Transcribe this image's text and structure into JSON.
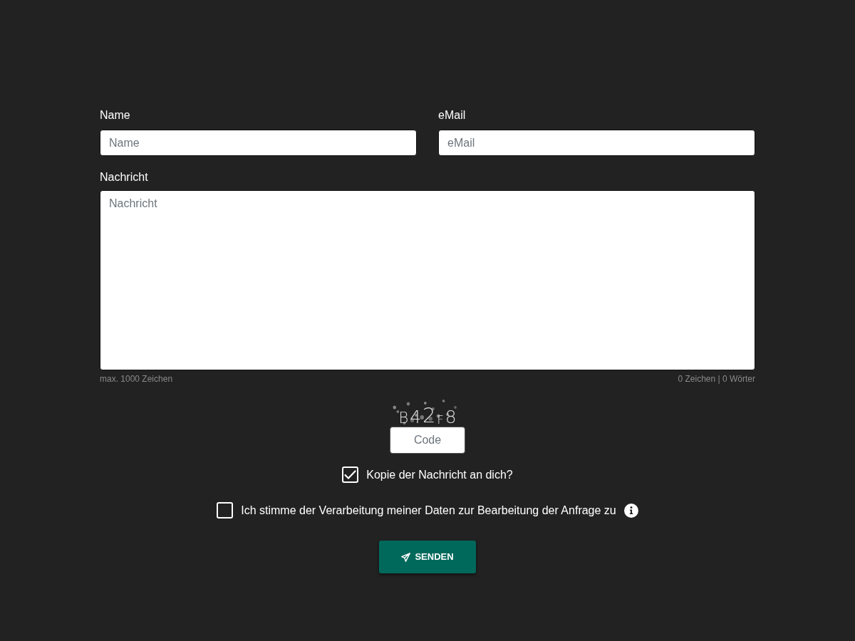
{
  "fields": [
    {
      "label": "Name",
      "placeholder": "Name"
    },
    {
      "label": "eMail",
      "placeholder": "eMail"
    }
  ],
  "message": {
    "label": "Nachricht",
    "placeholder": "Nachricht",
    "hint": "max. 1000 Zeichen",
    "counter": "0 Zeichen | 0 Wörter"
  },
  "captcha": {
    "code": "B42F8",
    "placeholder": "Code"
  },
  "checkboxes": [
    {
      "label": "Kopie der Nachricht an dich?",
      "checked": true,
      "info": false
    },
    {
      "label": "Ich stimme der Verarbeitung meiner Daten zur Bearbeitung der Anfrage zu",
      "checked": false,
      "info": true
    }
  ],
  "submit_button": {
    "label": "SENDEN"
  }
}
